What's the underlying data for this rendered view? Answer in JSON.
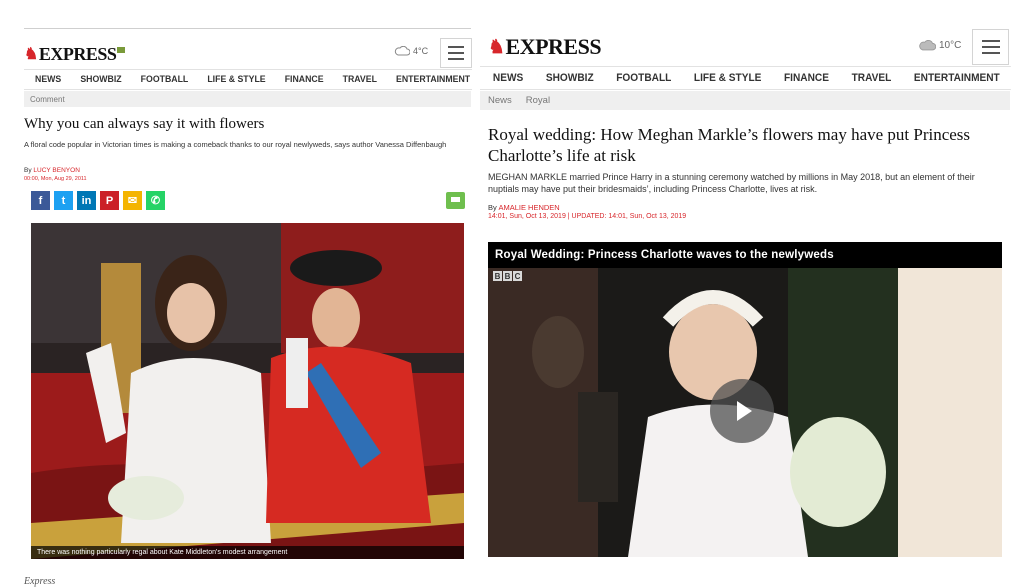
{
  "left": {
    "logo": "EXPRESS",
    "weather": "4°C",
    "nav": [
      "NEWS",
      "SHOWBIZ",
      "FOOTBALL",
      "LIFE & STYLE",
      "FINANCE",
      "TRAVEL",
      "ENTERTAINMENT"
    ],
    "breadcrumb": [
      "Comment"
    ],
    "headline": "Why you can always say it with flowers",
    "standfirst": "A floral code popular in Victorian times is making a comeback thanks to our royal newlyweds, says author Vanessa Diffenbaugh",
    "byline_prefix": "By",
    "author": "LUCY BENYON",
    "date": "00:00, Mon, Aug 29, 2011",
    "share": [
      {
        "icon": "facebook-icon",
        "glyph": "f",
        "color": "#3b5998"
      },
      {
        "icon": "twitter-icon",
        "glyph": "t",
        "color": "#1da1f2"
      },
      {
        "icon": "linkedin-icon",
        "glyph": "in",
        "color": "#0077b5"
      },
      {
        "icon": "pinterest-icon",
        "glyph": "P",
        "color": "#cb2027"
      },
      {
        "icon": "email-icon",
        "glyph": "✉",
        "color": "#f4b400"
      },
      {
        "icon": "whatsapp-icon",
        "glyph": "✆",
        "color": "#25d366"
      }
    ],
    "photo_caption": "There was nothing particularly regal about Kate Middleton's modest arrangement"
  },
  "right": {
    "logo": "EXPRESS",
    "weather": "10°C",
    "nav": [
      "NEWS",
      "SHOWBIZ",
      "FOOTBALL",
      "LIFE & STYLE",
      "FINANCE",
      "TRAVEL",
      "ENTERTAINMENT"
    ],
    "breadcrumb": [
      "News",
      "Royal"
    ],
    "headline": "Royal wedding: How Meghan Markle’s flowers may have put Princess Charlotte’s life at risk",
    "standfirst": "MEGHAN MARKLE married Prince Harry in a stunning ceremony watched by millions in May 2018, but an element of their nuptials may have put their bridesmaids’, including Princess Charlotte, lives at risk.",
    "byline_prefix": "By",
    "author": "AMALIE HENDEN",
    "date": "14:01, Sun, Oct 13, 2019 | UPDATED: 14:01, Sun, Oct 13, 2019",
    "video_title": "Royal Wedding: Princess Charlotte waves to the newlyweds",
    "bbc_letters": [
      "B",
      "B",
      "C"
    ]
  },
  "source": "Express",
  "colors": {
    "brand_red": "#d7262b",
    "crumb_bg": "#efefef"
  }
}
